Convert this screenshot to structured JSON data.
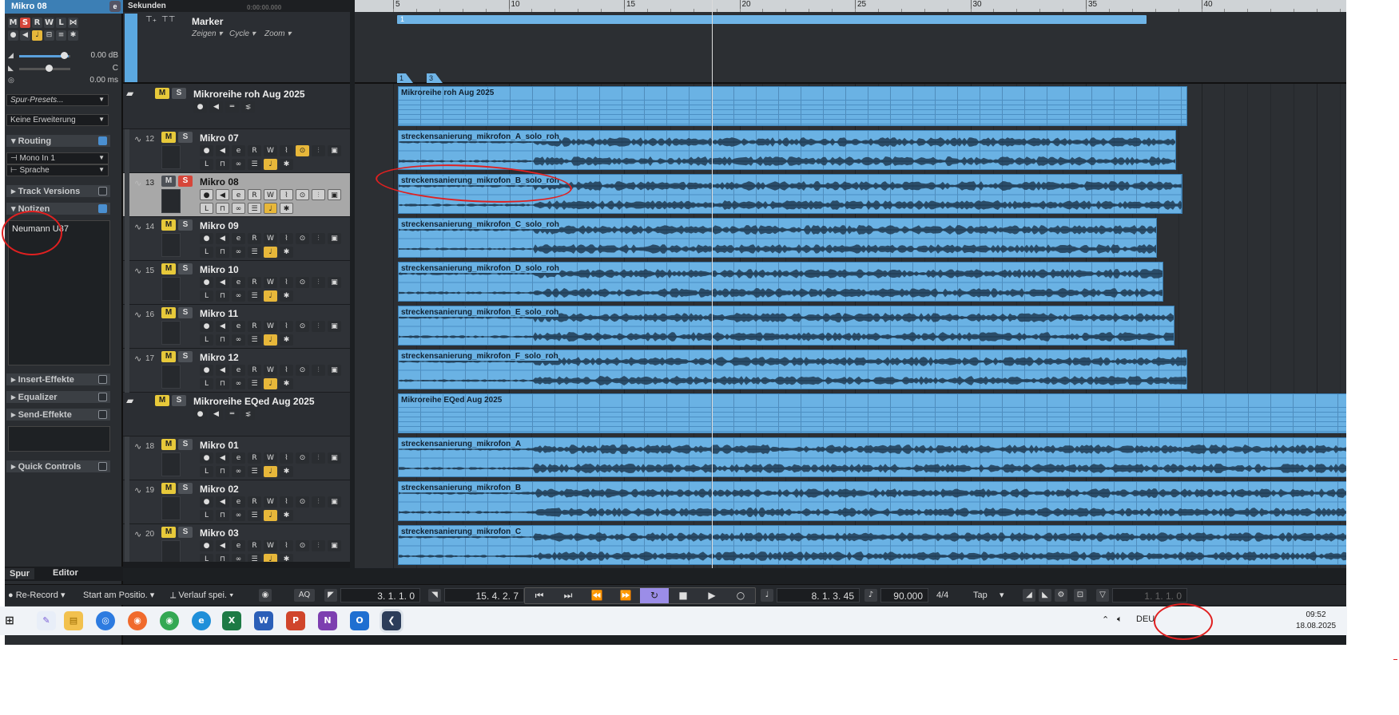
{
  "inspector": {
    "track_name": "Mikro 08",
    "buttons_row1": [
      "M",
      "S",
      "R",
      "W",
      "L",
      "⋈"
    ],
    "volume": "0.00 dB",
    "pan": "C",
    "delay": "0.00 ms",
    "presets_placeholder": "Spur-Presets...",
    "extension": "Keine Erweiterung",
    "sections": {
      "routing": "Routing",
      "input": "Mono In 1",
      "output": "Sprache",
      "track_versions": "Track Versions",
      "notes": "Notizen",
      "notes_text": "Neumann U87",
      "insert": "Insert-Effekte",
      "equalizer": "Equalizer",
      "send": "Send-Effekte",
      "quick": "Quick Controls"
    },
    "tabs": [
      "Spur",
      "Editor"
    ]
  },
  "tracklist": {
    "time_format": "Sekunden",
    "time_readout": "0:00:00.000",
    "marker": {
      "name": "Marker",
      "controls": [
        "Zeigen",
        "Cycle",
        "Zoom"
      ]
    },
    "tracks": [
      {
        "type": "folder",
        "name": "Mikroreihe roh Aug 2025"
      },
      {
        "type": "audio",
        "num": "12",
        "name": "Mikro 07",
        "muted": true,
        "solo": false,
        "selected": false,
        "monitor": true
      },
      {
        "type": "audio",
        "num": "13",
        "name": "Mikro 08",
        "muted": false,
        "solo": true,
        "selected": true,
        "monitor": false
      },
      {
        "type": "audio",
        "num": "14",
        "name": "Mikro 09",
        "muted": true,
        "solo": false,
        "selected": false,
        "monitor": false
      },
      {
        "type": "audio",
        "num": "15",
        "name": "Mikro 10",
        "muted": true,
        "solo": false,
        "selected": false,
        "monitor": false
      },
      {
        "type": "audio",
        "num": "16",
        "name": "Mikro 11",
        "muted": true,
        "solo": false,
        "selected": false,
        "monitor": false
      },
      {
        "type": "audio",
        "num": "17",
        "name": "Mikro 12",
        "muted": true,
        "solo": false,
        "selected": false,
        "monitor": false
      },
      {
        "type": "folder",
        "name": "Mikroreihe EQed Aug 2025"
      },
      {
        "type": "audio",
        "num": "18",
        "name": "Mikro 01",
        "muted": true,
        "solo": false,
        "selected": false,
        "monitor": false
      },
      {
        "type": "audio",
        "num": "19",
        "name": "Mikro 02",
        "muted": true,
        "solo": false,
        "selected": false,
        "monitor": false
      },
      {
        "type": "audio",
        "num": "20",
        "name": "Mikro 03",
        "muted": true,
        "solo": false,
        "selected": false,
        "monitor": false
      }
    ]
  },
  "ruler": {
    "labels": [
      "5",
      "10",
      "15",
      "20",
      "25",
      "30",
      "35",
      "40"
    ]
  },
  "arrange": {
    "cycle_label": "1",
    "markers": [
      "1",
      "3"
    ],
    "folder_parts": [
      "Mikroreihe roh Aug 2025",
      "Mikroreihe EQed Aug 2025"
    ],
    "events": [
      "streckensanierung_mikrofon_A_solo_roh",
      "streckensanierung_mikrofon_B_solo_roh",
      "streckensanierung_mikrofon_C_solo_roh",
      "streckensanierung_mikrofon_D_solo_roh",
      "streckensanierung_mikrofon_E_solo_roh",
      "streckensanierung_mikrofon_F_solo_roh",
      "streckensanierung_mikrofon_A",
      "streckensanierung_mikrofon_B",
      "streckensanierung_mikrofon_C"
    ]
  },
  "transport": {
    "record_mode": "Re-Record",
    "start_mode": "Start am Positio.",
    "history": "Verlauf spei.",
    "aq": "AQ",
    "left_locator": "3. 1. 1.   0",
    "right_locator": "15. 4. 2.   7",
    "position": "8. 1. 3. 45",
    "tempo": "90.000",
    "signature": "4/4",
    "tap": "Tap",
    "secondary_position": "1. 1. 1.   0"
  },
  "taskbar": {
    "language": "DEU",
    "time": "09:52",
    "date": "18.08.2025"
  },
  "colors": {
    "event_blue": "#6ab2e4",
    "mute_yellow": "#e7c93a",
    "solo_red": "#d6463a",
    "cursor": "#dcdcdc",
    "annotation": "#e02020"
  }
}
